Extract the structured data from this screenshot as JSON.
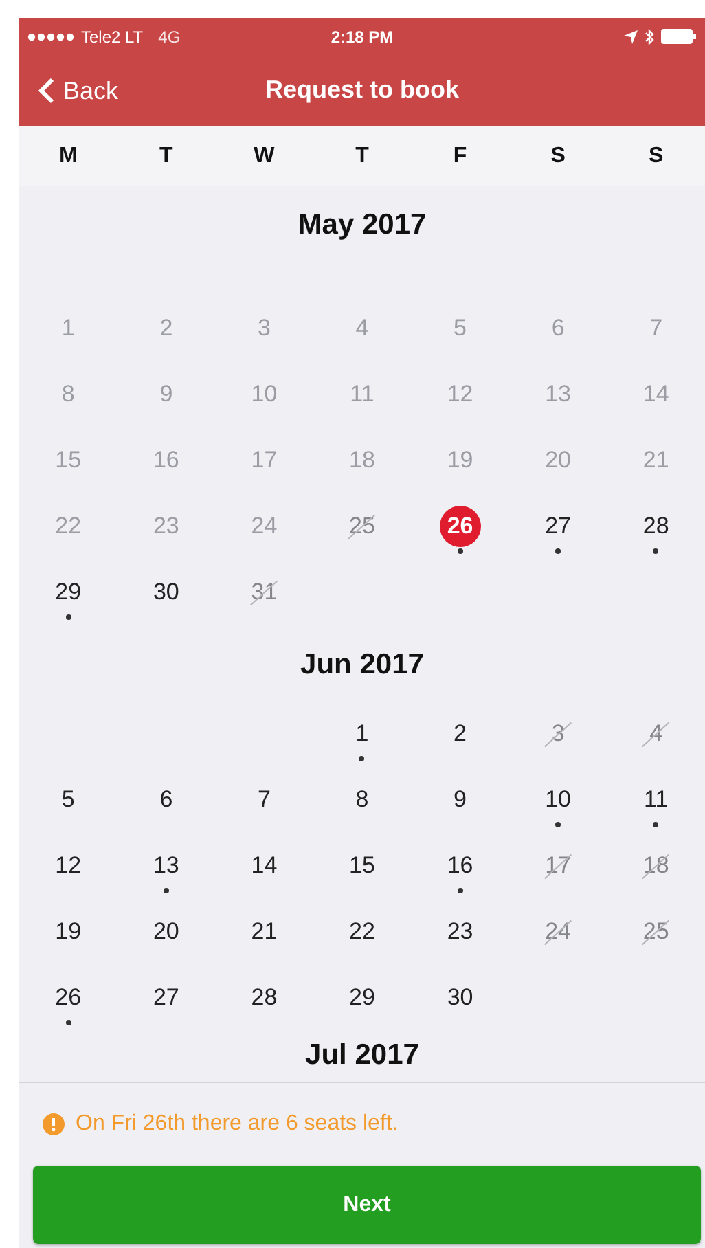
{
  "status_bar": {
    "carrier": "Tele2 LT",
    "network": "4G",
    "time": "2:18 PM"
  },
  "nav": {
    "back": "Back",
    "title": "Request to book"
  },
  "weekdays": [
    "M",
    "T",
    "W",
    "T",
    "F",
    "S",
    "S"
  ],
  "months": [
    {
      "title": "May 2017",
      "days": [
        {
          "kind": "day",
          "label": "1",
          "disabled": true,
          "crossed_out": false,
          "selected": false,
          "marked": false
        },
        {
          "kind": "day",
          "label": "2",
          "disabled": true,
          "crossed_out": false,
          "selected": false,
          "marked": false
        },
        {
          "kind": "day",
          "label": "3",
          "disabled": true,
          "crossed_out": false,
          "selected": false,
          "marked": false
        },
        {
          "kind": "day",
          "label": "4",
          "disabled": true,
          "crossed_out": false,
          "selected": false,
          "marked": false
        },
        {
          "kind": "day",
          "label": "5",
          "disabled": true,
          "crossed_out": false,
          "selected": false,
          "marked": false
        },
        {
          "kind": "day",
          "label": "6",
          "disabled": true,
          "crossed_out": false,
          "selected": false,
          "marked": false
        },
        {
          "kind": "day",
          "label": "7",
          "disabled": true,
          "crossed_out": false,
          "selected": false,
          "marked": false
        },
        {
          "kind": "day",
          "label": "8",
          "disabled": true,
          "crossed_out": false,
          "selected": false,
          "marked": false
        },
        {
          "kind": "day",
          "label": "9",
          "disabled": true,
          "crossed_out": false,
          "selected": false,
          "marked": false
        },
        {
          "kind": "day",
          "label": "10",
          "disabled": true,
          "crossed_out": false,
          "selected": false,
          "marked": false
        },
        {
          "kind": "day",
          "label": "11",
          "disabled": true,
          "crossed_out": false,
          "selected": false,
          "marked": false
        },
        {
          "kind": "day",
          "label": "12",
          "disabled": true,
          "crossed_out": false,
          "selected": false,
          "marked": false
        },
        {
          "kind": "day",
          "label": "13",
          "disabled": true,
          "crossed_out": false,
          "selected": false,
          "marked": false
        },
        {
          "kind": "day",
          "label": "14",
          "disabled": true,
          "crossed_out": false,
          "selected": false,
          "marked": false
        },
        {
          "kind": "day",
          "label": "15",
          "disabled": true,
          "crossed_out": false,
          "selected": false,
          "marked": false
        },
        {
          "kind": "day",
          "label": "16",
          "disabled": true,
          "crossed_out": false,
          "selected": false,
          "marked": false
        },
        {
          "kind": "day",
          "label": "17",
          "disabled": true,
          "crossed_out": false,
          "selected": false,
          "marked": false
        },
        {
          "kind": "day",
          "label": "18",
          "disabled": true,
          "crossed_out": false,
          "selected": false,
          "marked": false
        },
        {
          "kind": "day",
          "label": "19",
          "disabled": true,
          "crossed_out": false,
          "selected": false,
          "marked": false
        },
        {
          "kind": "day",
          "label": "20",
          "disabled": true,
          "crossed_out": false,
          "selected": false,
          "marked": false
        },
        {
          "kind": "day",
          "label": "21",
          "disabled": true,
          "crossed_out": false,
          "selected": false,
          "marked": false
        },
        {
          "kind": "day",
          "label": "22",
          "disabled": true,
          "crossed_out": false,
          "selected": false,
          "marked": false
        },
        {
          "kind": "day",
          "label": "23",
          "disabled": true,
          "crossed_out": false,
          "selected": false,
          "marked": false
        },
        {
          "kind": "day",
          "label": "24",
          "disabled": true,
          "crossed_out": false,
          "selected": false,
          "marked": false
        },
        {
          "kind": "day",
          "label": "25",
          "disabled": false,
          "crossed_out": true,
          "selected": false,
          "marked": false
        },
        {
          "kind": "day",
          "label": "26",
          "disabled": false,
          "crossed_out": false,
          "selected": true,
          "marked": true
        },
        {
          "kind": "day",
          "label": "27",
          "disabled": false,
          "crossed_out": false,
          "selected": false,
          "marked": true
        },
        {
          "kind": "day",
          "label": "28",
          "disabled": false,
          "crossed_out": false,
          "selected": false,
          "marked": true
        },
        {
          "kind": "day",
          "label": "29",
          "disabled": false,
          "crossed_out": false,
          "selected": false,
          "marked": true
        },
        {
          "kind": "day",
          "label": "30",
          "disabled": false,
          "crossed_out": false,
          "selected": false,
          "marked": false
        },
        {
          "kind": "day",
          "label": "31",
          "disabled": false,
          "crossed_out": true,
          "selected": false,
          "marked": false
        }
      ]
    },
    {
      "title": "Jun 2017",
      "days": [
        {
          "kind": "blank"
        },
        {
          "kind": "blank"
        },
        {
          "kind": "blank"
        },
        {
          "kind": "day",
          "label": "1",
          "disabled": false,
          "crossed_out": false,
          "selected": false,
          "marked": true
        },
        {
          "kind": "day",
          "label": "2",
          "disabled": false,
          "crossed_out": false,
          "selected": false,
          "marked": false
        },
        {
          "kind": "day",
          "label": "3",
          "disabled": false,
          "crossed_out": true,
          "selected": false,
          "marked": false
        },
        {
          "kind": "day",
          "label": "4",
          "disabled": false,
          "crossed_out": true,
          "selected": false,
          "marked": false
        },
        {
          "kind": "day",
          "label": "5",
          "disabled": false,
          "crossed_out": false,
          "selected": false,
          "marked": false
        },
        {
          "kind": "day",
          "label": "6",
          "disabled": false,
          "crossed_out": false,
          "selected": false,
          "marked": false
        },
        {
          "kind": "day",
          "label": "7",
          "disabled": false,
          "crossed_out": false,
          "selected": false,
          "marked": false
        },
        {
          "kind": "day",
          "label": "8",
          "disabled": false,
          "crossed_out": false,
          "selected": false,
          "marked": false
        },
        {
          "kind": "day",
          "label": "9",
          "disabled": false,
          "crossed_out": false,
          "selected": false,
          "marked": false
        },
        {
          "kind": "day",
          "label": "10",
          "disabled": false,
          "crossed_out": false,
          "selected": false,
          "marked": true
        },
        {
          "kind": "day",
          "label": "11",
          "disabled": false,
          "crossed_out": false,
          "selected": false,
          "marked": true
        },
        {
          "kind": "day",
          "label": "12",
          "disabled": false,
          "crossed_out": false,
          "selected": false,
          "marked": false
        },
        {
          "kind": "day",
          "label": "13",
          "disabled": false,
          "crossed_out": false,
          "selected": false,
          "marked": true
        },
        {
          "kind": "day",
          "label": "14",
          "disabled": false,
          "crossed_out": false,
          "selected": false,
          "marked": false
        },
        {
          "kind": "day",
          "label": "15",
          "disabled": false,
          "crossed_out": false,
          "selected": false,
          "marked": false
        },
        {
          "kind": "day",
          "label": "16",
          "disabled": false,
          "crossed_out": false,
          "selected": false,
          "marked": true
        },
        {
          "kind": "day",
          "label": "17",
          "disabled": false,
          "crossed_out": true,
          "selected": false,
          "marked": false
        },
        {
          "kind": "day",
          "label": "18",
          "disabled": false,
          "crossed_out": true,
          "selected": false,
          "marked": false
        },
        {
          "kind": "day",
          "label": "19",
          "disabled": false,
          "crossed_out": false,
          "selected": false,
          "marked": false
        },
        {
          "kind": "day",
          "label": "20",
          "disabled": false,
          "crossed_out": false,
          "selected": false,
          "marked": false
        },
        {
          "kind": "day",
          "label": "21",
          "disabled": false,
          "crossed_out": false,
          "selected": false,
          "marked": false
        },
        {
          "kind": "day",
          "label": "22",
          "disabled": false,
          "crossed_out": false,
          "selected": false,
          "marked": false
        },
        {
          "kind": "day",
          "label": "23",
          "disabled": false,
          "crossed_out": false,
          "selected": false,
          "marked": false
        },
        {
          "kind": "day",
          "label": "24",
          "disabled": false,
          "crossed_out": true,
          "selected": false,
          "marked": false
        },
        {
          "kind": "day",
          "label": "25",
          "disabled": false,
          "crossed_out": true,
          "selected": false,
          "marked": false
        },
        {
          "kind": "day",
          "label": "26",
          "disabled": false,
          "crossed_out": false,
          "selected": false,
          "marked": true
        },
        {
          "kind": "day",
          "label": "27",
          "disabled": false,
          "crossed_out": false,
          "selected": false,
          "marked": false
        },
        {
          "kind": "day",
          "label": "28",
          "disabled": false,
          "crossed_out": false,
          "selected": false,
          "marked": false
        },
        {
          "kind": "day",
          "label": "29",
          "disabled": false,
          "crossed_out": false,
          "selected": false,
          "marked": false
        },
        {
          "kind": "day",
          "label": "30",
          "disabled": false,
          "crossed_out": false,
          "selected": false,
          "marked": false
        }
      ]
    },
    {
      "title": "Jul 2017"
    }
  ],
  "notice": "On Fri 26th there are 6 seats left.",
  "next_button": "Next"
}
